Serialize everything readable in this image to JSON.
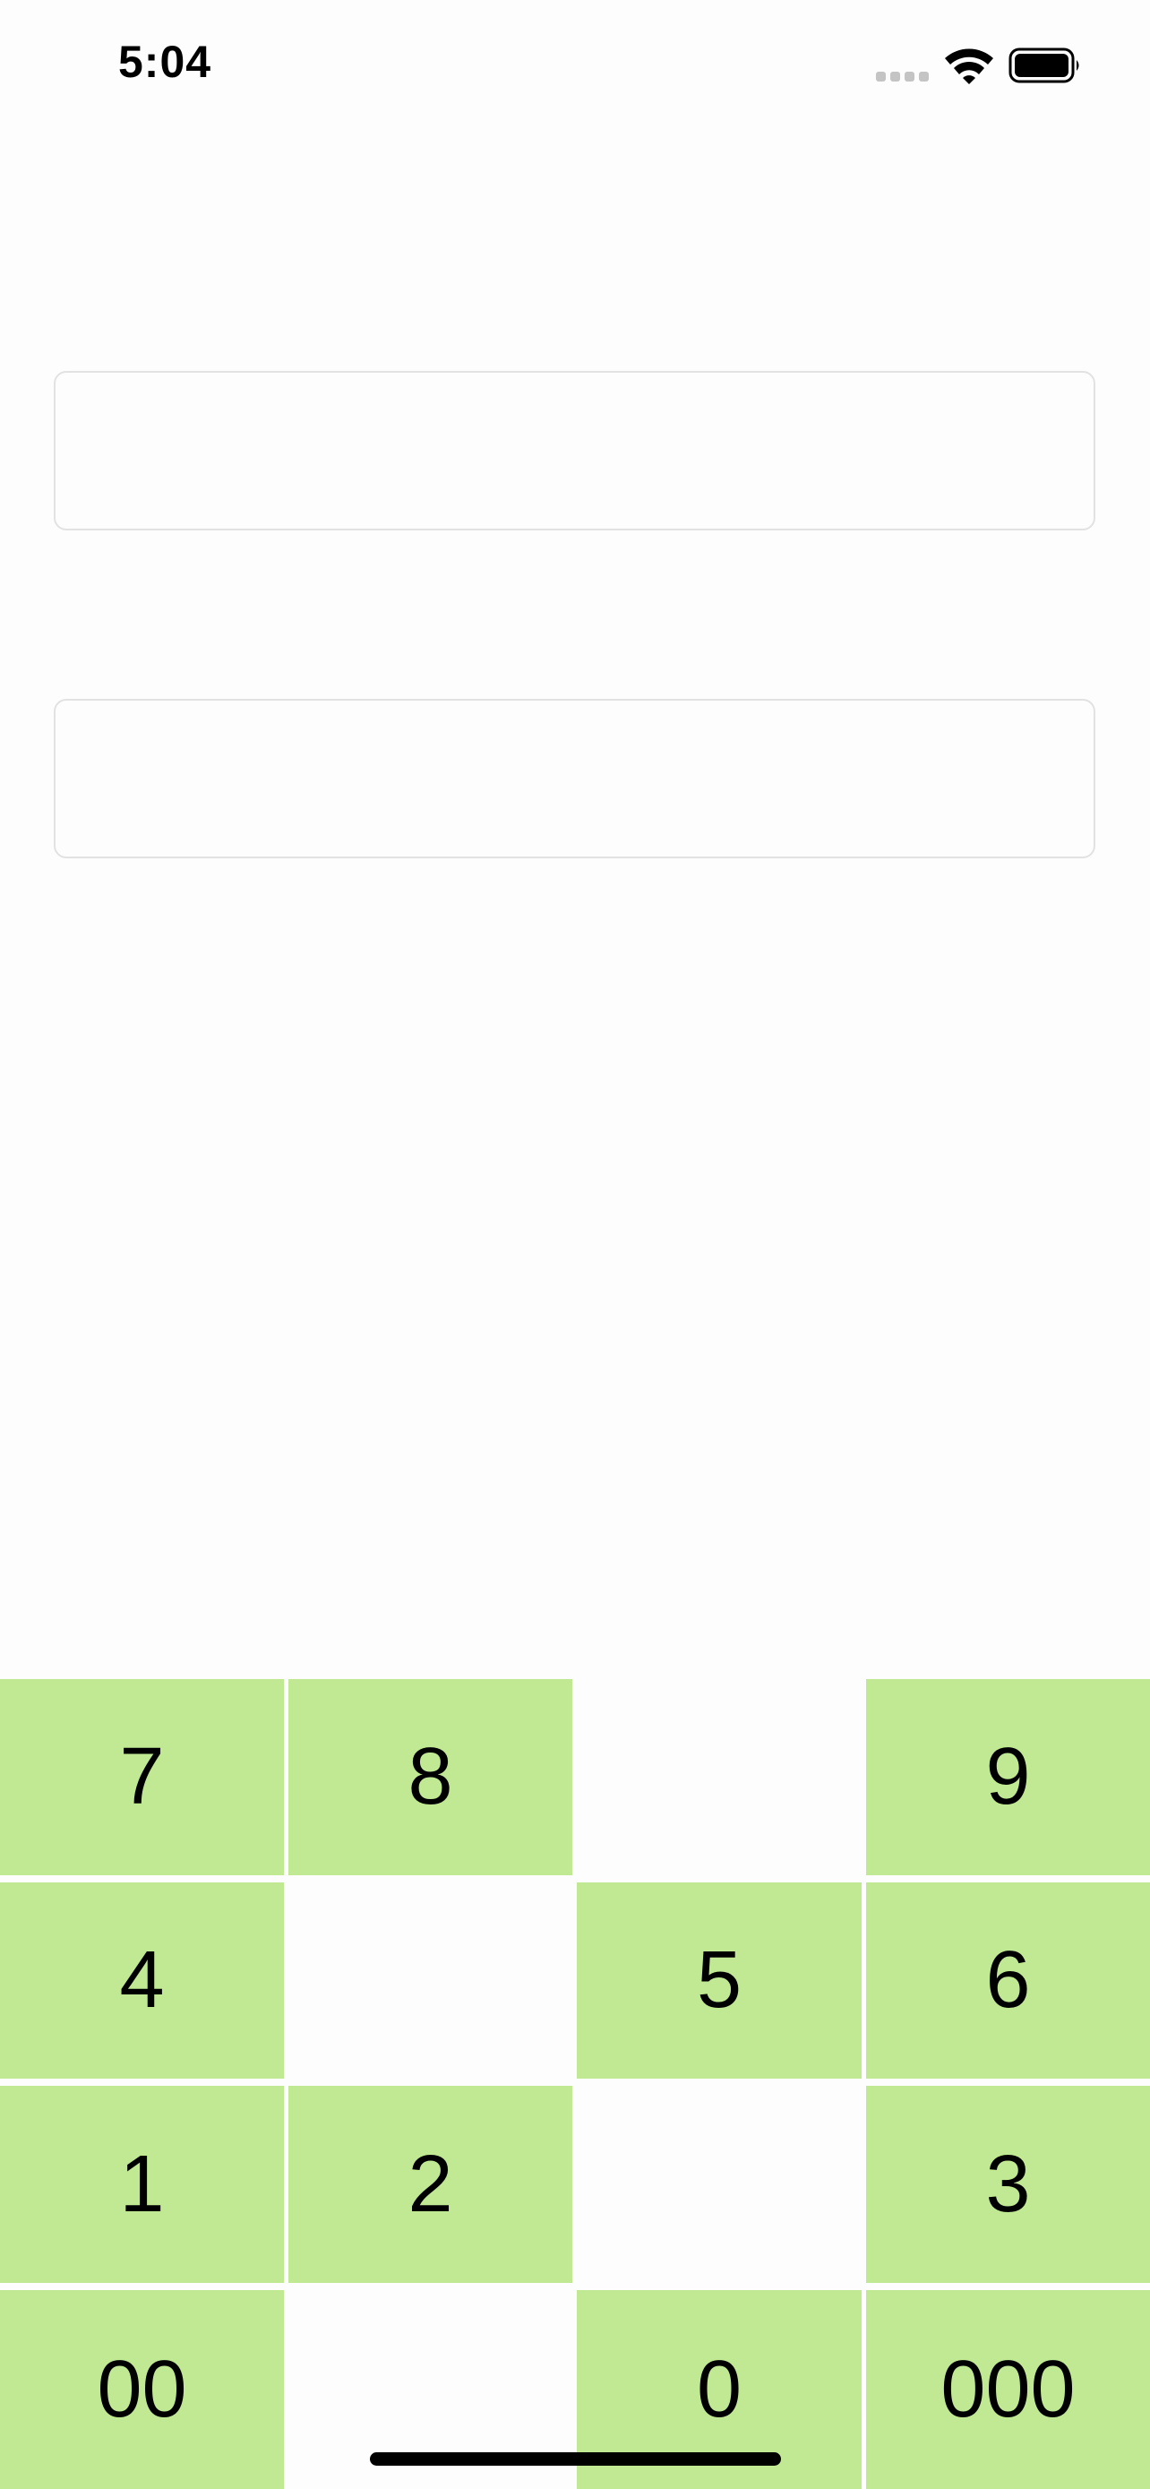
{
  "status_bar": {
    "time": "5:04",
    "signal_icon": "cellular-signal-icon",
    "wifi_icon": "wifi-icon",
    "battery_icon": "battery-icon"
  },
  "form": {
    "field_1": {
      "value": "",
      "placeholder": ""
    },
    "field_2": {
      "value": "",
      "placeholder": ""
    }
  },
  "keypad": {
    "key_color": "#c1e994",
    "rows": [
      [
        "7",
        "8",
        "",
        "9"
      ],
      [
        "4",
        "",
        "5",
        "6"
      ],
      [
        "1",
        "2",
        "",
        "3"
      ],
      [
        "00",
        "",
        "0",
        "000"
      ]
    ]
  }
}
